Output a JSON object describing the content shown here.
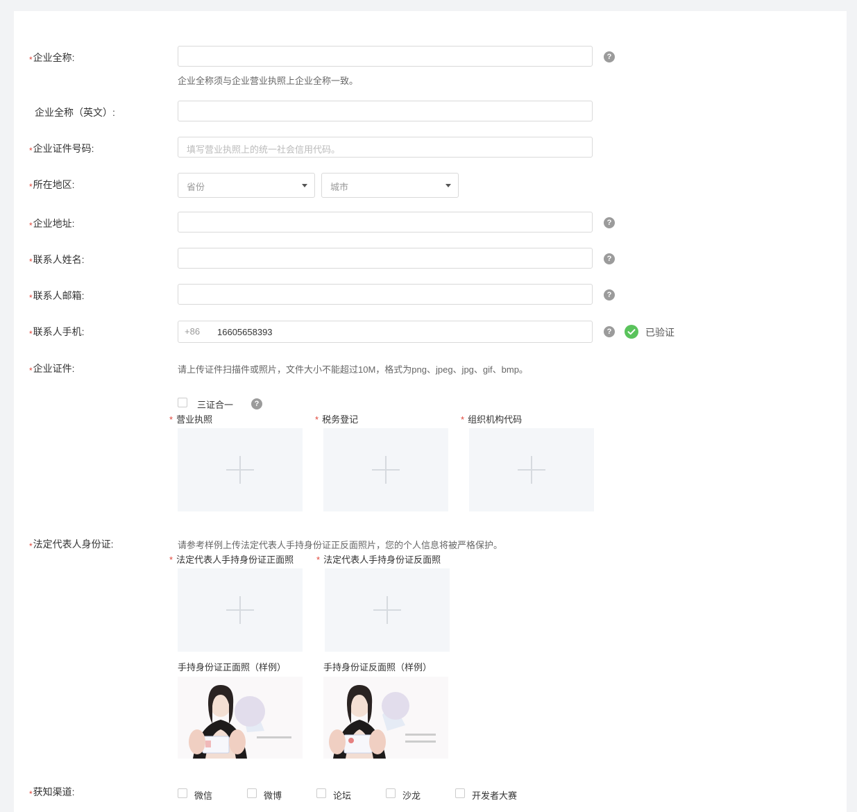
{
  "form": {
    "company_name": {
      "label": "企业全称:",
      "hint": "企业全称须与企业营业执照上企业全称一致。",
      "value": ""
    },
    "company_name_en": {
      "label": "企业全称（英文）:",
      "value": ""
    },
    "cert_number": {
      "label": "企业证件号码:",
      "placeholder": "填写营业执照上的统一社会信用代码。"
    },
    "region": {
      "label": "所在地区:",
      "province": "省份",
      "city": "城市"
    },
    "address": {
      "label": "企业地址:",
      "value": ""
    },
    "contact_name": {
      "label": "联系人姓名:",
      "value": ""
    },
    "contact_email": {
      "label": "联系人邮箱:",
      "value": ""
    },
    "contact_phone": {
      "label": "联系人手机:",
      "prefix": "+86",
      "value": "16605658393",
      "verified": "已验证"
    },
    "certificates": {
      "label": "企业证件:",
      "hint": "请上传证件扫描件或照片，文件大小不能超过10M，格式为png、jpeg、jpg、gif、bmp。",
      "three_in_one": "三证合一",
      "uploads": [
        "营业执照",
        "税务登记",
        "组织机构代码"
      ]
    },
    "legal_id": {
      "label": "法定代表人身份证:",
      "hint": "请参考样例上传法定代表人手持身份证正反面照片，您的个人信息将被严格保护。",
      "uploads": [
        "法定代表人手持身份证正面照",
        "法定代表人手持身份证反面照"
      ],
      "samples": [
        "手持身份证正面照（样例）",
        "手持身份证反面照（样例）"
      ]
    },
    "channel": {
      "label": "获知渠道:",
      "options": [
        "微信",
        "微博",
        "论坛",
        "沙龙",
        "开发者大赛"
      ]
    }
  },
  "colors": {
    "required": "#e0463a",
    "verified": "#5ac35c",
    "help": "#9b9b9b",
    "upload_bg": "#f4f6f9"
  },
  "icons": {
    "help": "question-circle-icon",
    "verified": "check-circle-icon",
    "upload": "plus-icon",
    "dropdown": "caret-down-icon"
  }
}
